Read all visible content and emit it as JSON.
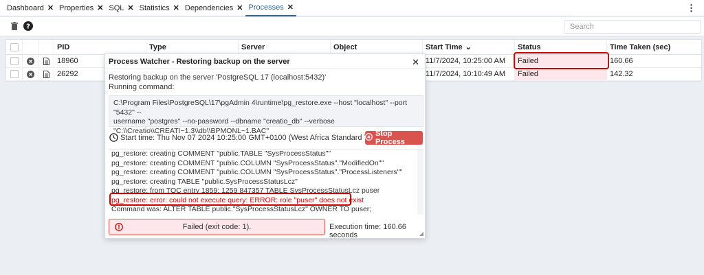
{
  "tabs": [
    {
      "label": "Dashboard"
    },
    {
      "label": "Properties"
    },
    {
      "label": "SQL"
    },
    {
      "label": "Statistics"
    },
    {
      "label": "Dependencies"
    },
    {
      "label": "Processes"
    }
  ],
  "tab_close_glyph": "✕",
  "toolbar": {
    "search_placeholder": "Search",
    "delete_icon": "trash-icon",
    "help_icon": "help-icon"
  },
  "grid": {
    "headers": {
      "pid": "PID",
      "type": "Type",
      "server": "Server",
      "object": "Object",
      "start_time": "Start Time",
      "status": "Status",
      "time_taken": "Time Taken (sec)"
    },
    "rows": [
      {
        "pid": "18960",
        "start_time": "11/7/2024, 10:25:00 AM",
        "status": "Failed",
        "time_taken": "160.66"
      },
      {
        "pid": "26292",
        "start_time": "11/7/2024, 10:10:49 AM",
        "status": "Failed",
        "time_taken": "142.32"
      }
    ]
  },
  "dialog": {
    "title": "Process Watcher - Restoring backup on the server",
    "description": "Restoring backup on the server 'PostgreSQL 17 (localhost:5432)'",
    "running_label": "Running command:",
    "command_lines": [
      "C:\\Program Files\\PostgreSQL\\17\\pgAdmin 4\\runtime\\pg_restore.exe --host \"localhost\" --port \"5432\" --",
      "username \"postgres\" --no-password --dbname \"creatio_db\" --verbose",
      "\"C:\\\\Creatio\\\\CREATI~1.3\\\\db\\\\BPMONL~1.BAC\""
    ],
    "start_time": "Start time: Thu Nov 07 2024 10:25:00 GMT+0100 (West Africa Standard Time)",
    "stop_button": "Stop Process",
    "log_lines": [
      "pg_restore: creating COMMENT \"public.TABLE \"SysProcessStatus\"\"",
      "pg_restore: creating COMMENT \"public.COLUMN \"SysProcessStatus\".\"ModifiedOn\"\"",
      "pg_restore: creating COMMENT \"public.COLUMN \"SysProcessStatus\".\"ProcessListeners\"\"",
      "pg_restore: creating TABLE \"public.SysProcessStatusLcz\"",
      "pg_restore: from TOC entry 1859; 1259 847357 TABLE SysProcessStatusLcz puser",
      "pg_restore: error: could not execute query: ERROR:  role \"puser\" does not exist",
      "Command was: ALTER TABLE public.\"SysProcessStatusLcz\" OWNER TO puser;"
    ],
    "fail_message": "Failed (exit code: 1).",
    "execution_time": "Execution time: 160.66 seconds"
  }
}
